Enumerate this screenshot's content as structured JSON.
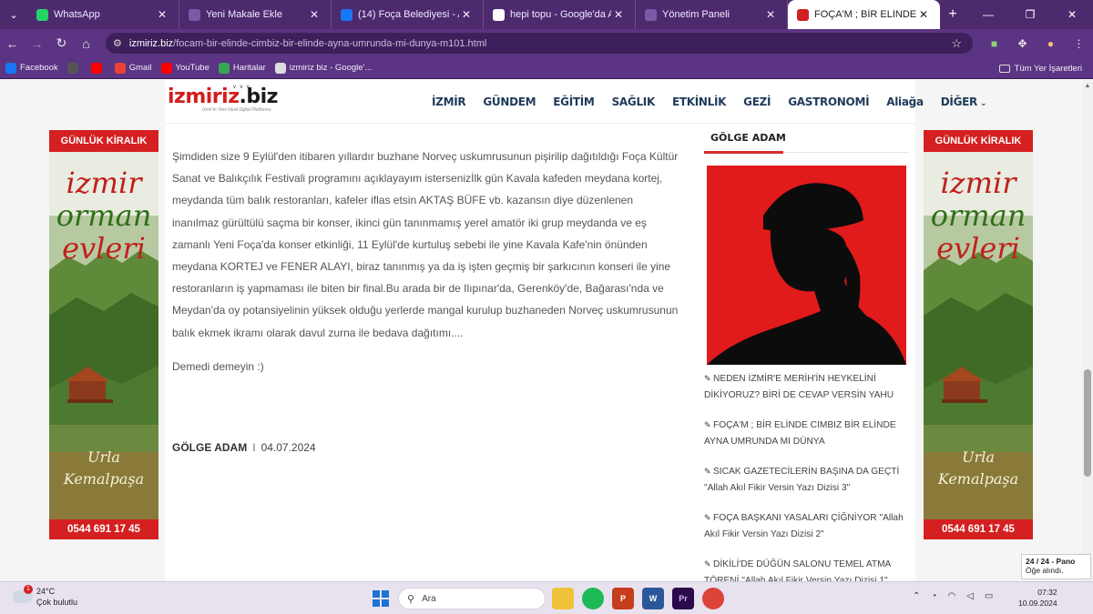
{
  "browser": {
    "tabs": [
      {
        "title": "WhatsApp",
        "icon_color": "#25d366",
        "active": false
      },
      {
        "title": "Yeni Makale Ekle",
        "icon_color": "#7a5aa6",
        "active": false
      },
      {
        "title": "(14) Foça Belediyesi - Arama",
        "icon_color": "#1877f2",
        "active": false
      },
      {
        "title": "hepi topu - Google'da Ara",
        "icon_color": "#ffffff",
        "active": false
      },
      {
        "title": "Yönetim Paneli",
        "icon_color": "#7a5aa6",
        "active": false
      },
      {
        "title": "FOÇA'M ; BİR ELİNDE CIMBIZ",
        "icon_color": "#d32020",
        "active": true
      }
    ],
    "url_domain": "izmiriz.biz",
    "url_path": "/focam-bir-elinde-cimbiz-bir-elinde-ayna-umrunda-mi-dunya-m101.html",
    "bookmarks": [
      {
        "label": "Facebook",
        "icon_color": "#1877f2"
      },
      {
        "label": "",
        "icon_color": "#555555"
      },
      {
        "label": "",
        "icon_color": "#ff0000"
      },
      {
        "label": "Gmail",
        "icon_color": "#ea4335"
      },
      {
        "label": "YouTube",
        "icon_color": "#ff0000"
      },
      {
        "label": "Haritalar",
        "icon_color": "#34a853"
      },
      {
        "label": "izmiriz biz - Google'...",
        "icon_color": "#dddddd"
      }
    ],
    "all_bookmarks": "Tüm Yer İşaretleri"
  },
  "site": {
    "logo_text_red": "izmiriz",
    "logo_text_black": ".biz",
    "logo_tagline": "İzmir'in Yeni Nesil Dijital Platformu",
    "menu": [
      "İZMİR",
      "GÜNDEM",
      "EĞİTİM",
      "SAĞLIK",
      "ETKİNLİK",
      "GEZİ",
      "GASTRONOMİ",
      "Aliağa",
      "DİĞER"
    ]
  },
  "article": {
    "body": "Şimdiden size  9 Eylül'den itibaren yıllardır buzhane Norveç uskumrusunun pişirilip dağıtıldığı Foça Kültür Sanat ve Balıkçılık Festivali programını açıklayayım istersenizİlk gün Kavala kafeden meydana kortej, meydanda tüm balık restoranları, kafeler iflas etsin AKTAŞ BÜFE vb. kazansın diye düzenlenen inanılmaz gürültülü saçma bir konser, ikinci gün tanınmamış yerel amatör iki grup meydanda ve eş zamanlı Yeni Foça'da konser etkinliği, 11 Eylül'de kurtuluş sebebi ile yine Kavala Kafe'nin önünden meydana KORTEJ ve FENER ALAYI, biraz tanınmış ya da iş işten geçmiş bir şarkıcının konseri ile yine restoranların iş yapmaması ile biten bir final.Bu arada bir de Ilıpınar'da, Gerenköy'de, Bağarası'nda ve Meydan'da oy potansiyelinin yüksek olduğu yerlerde mangal kurulup buzhaneden Norveç uskumrusunun balık ekmek ikramı olarak davul zurna ile bedava dağıtımı....",
    "trail": "Demedi demeyin :)",
    "author": "GÖLGE ADAM",
    "date": "04.07.2024"
  },
  "sidebar": {
    "title": "GÖLGE ADAM",
    "items": [
      "NEDEN İZMİR'E MERİH'İN HEYKELİNİ DİKİYORUZ? BİRİ DE CEVAP VERSİN YAHU",
      "FOÇA'M ; BİR ELİNDE CIMBIZ BİR ELİNDE AYNA UMRUNDA MI DÜNYA",
      "SICAK GAZETECİLERİN BAŞINA DA GEÇTİ \"Allah Akıl Fikir Versin Yazı Dizisi 3\"",
      "FOÇA BAŞKANI YASALARI ÇİĞNİYOR \"Allah Akıl Fikir Versin Yazı Dizisi 2\"",
      "DİKİLİ'DE DÜĞÜN SALONU TEMEL ATMA TÖRENİ \"Allah Akıl Fikir Versin Yazı Dizisi 1\""
    ]
  },
  "ad": {
    "top": "GÜNLÜK  KİRALIK",
    "line1": "izmir",
    "line2": "orman",
    "line3": "evleri",
    "town1": "Urla",
    "town2": "Kemalpaşa",
    "phone": "0544 691 17 45"
  },
  "toast": {
    "title": "24 / 24 - Pano",
    "text": "Öğe alındı."
  },
  "taskbar": {
    "temp": "24°C",
    "weather": "Çok bulutlu",
    "weather_badge": "1",
    "search": "Ara",
    "time": "07:32",
    "date": "10.09.2024"
  }
}
